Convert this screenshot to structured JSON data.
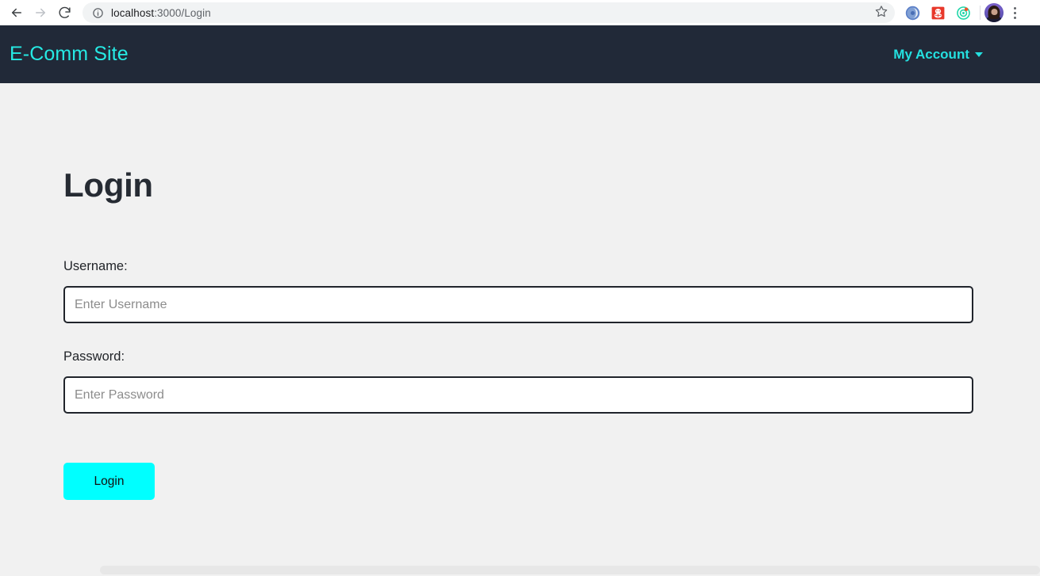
{
  "browser": {
    "back_icon": "back-arrow-icon",
    "forward_icon": "forward-arrow-icon",
    "reload_icon": "reload-icon",
    "info_icon": "site-info-icon",
    "url_host": "localhost",
    "url_path": ":3000/Login",
    "url_full": "localhost:3000/Login",
    "bookmark_icon": "star-icon",
    "extensions": [
      {
        "name": "extension-icon-blue-orb",
        "color": "#5b7fc7"
      },
      {
        "name": "extension-icon-red-square",
        "color": "#e8382b"
      },
      {
        "name": "extension-icon-green-target",
        "color": "#1fd6a8"
      }
    ],
    "avatar_name": "profile-avatar",
    "menu_icon": "three-dot-menu-icon"
  },
  "navbar": {
    "brand": "E-Comm Site",
    "account_label": "My Account",
    "caret_icon": "chevron-down-icon",
    "bg_color": "#212938",
    "accent_color": "#24e0e0"
  },
  "main": {
    "title": "Login",
    "username": {
      "label": "Username:",
      "placeholder": "Enter Username",
      "value": ""
    },
    "password": {
      "label": "Password:",
      "placeholder": "Enter Password",
      "value": ""
    },
    "submit_label": "Login",
    "submit_color": "#00ffff",
    "page_bg": "#f1f1f1"
  }
}
